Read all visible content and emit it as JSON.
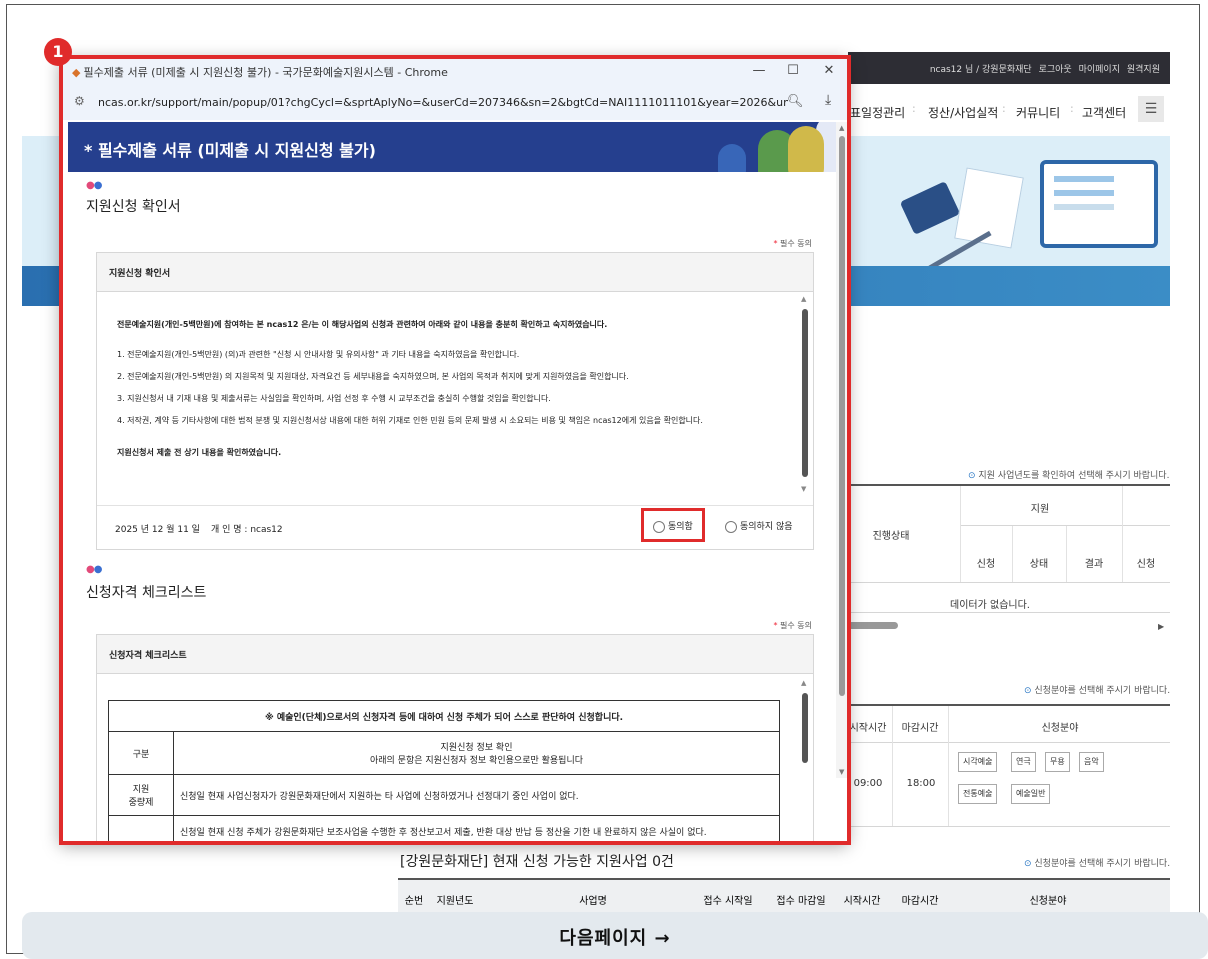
{
  "popup": {
    "window_title": "필수제출 서류 (미제출 시 지원신청 불가) - 국가문화예술지원시스템 - Chrome",
    "minimize": "—",
    "maximize": "☐",
    "close": "✕",
    "url": "ncas.or.kr/support/main/popup/01?chgCycl=&sprtAplyNo=&userCd=207346&sn=2&bgtCd=NAI1111011101&year=2026&unitBizC...",
    "header_title": "* 필수제출 서류 (미제출 시 지원신청 불가)",
    "section1": {
      "title": "지원신청 확인서",
      "required_label": "필수 동의",
      "box_title": "지원신청 확인서",
      "lead": "전문예술지원(개인-5백만원)에 참여하는 본 ncas12 은/는 이 해당사업의 신청과 관련하여 아래와 같이 내용을 충분히 확인하고 숙지하였습니다.",
      "items": [
        "1. 전문예술지원(개인-5백만원) (의)과 관련한 \"신청 시 안내사항 및 유의사항\" 과 기타 내용을 숙지하였음을 확인합니다.",
        "2. 전문예술지원(개인-5백만원) 의 지원목적 및 지원대상, 자격요건 등 세부내용을 숙지하였으며, 본 사업의 목적과 취지에 맞게 지원하였음을 확인합니다.",
        "3. 지원신청서 내 기재 내용 및 제출서류는 사실임을 확인하며, 사업 선정 후 수행 시 교부조건을 충실히 수행할 것임을 확인합니다.",
        "4. 저작권, 계약 등 기타사항에 대한 법적 분쟁 및 지원신청서상 내용에 대한 허위 기재로 인한 민원 등의 문제 발생 시 소요되는 비용 및 책임은 ncas12에게 있음을 확인합니다."
      ],
      "closing": "지원신청서 제출 전 상기 내용을 확인하였습니다.",
      "date": "2025 년 12 월 11 일",
      "person": "개 인 명 : ncas12",
      "agree": "동의함",
      "disagree": "동의하지 않음"
    },
    "section2": {
      "title": "신청자격 체크리스트",
      "required_label": "필수 동의",
      "box_title": "신청자격 체크리스트",
      "table_title": "※ 예술인(단체)으로서의 신청자격 등에 대하여 신청 주체가 되어 스스로 판단하여 신청합니다.",
      "col1_header": "구분",
      "col2_header_line1": "지원신청 정보 확인",
      "col2_header_line2": "아래의 문항은 지원신청자 정보 확인용으로만 활용됩니다",
      "row1_label_line1": "지원",
      "row1_label_line2": "중량제",
      "row1_text": "신청일 현재 사업신청자가 강원문화재단에서 지원하는 타 사업에 신청하였거나 선정대기 중인 사업이 없다.",
      "row2_text": "신청일 현재 신청 주체가 강원문화재단 보조사업을 수행한 후 정산보고서 제출, 반환 대상 반납 등 정산을 기한 내 완료하지 않은 사실이 없다."
    }
  },
  "background_site": {
    "top_links": [
      "ncas12 님 / 강원문화재단",
      "로그아웃",
      "마이페이지",
      "원격지원"
    ],
    "nav": [
      "표일정관리",
      "정산/사업실적",
      "커뮤니티",
      "고객센터"
    ],
    "note1": "지원 사업년도를 확인하여 선택해 주시기 바랍니다.",
    "table1": {
      "status_header": "진행상태",
      "group_header": "지원",
      "sub_headers": [
        "신청",
        "상태",
        "결과",
        "신청"
      ],
      "empty": "데이터가 없습니다."
    },
    "note2": "신청분야를 선택해 주시기 바랍니다.",
    "table2": {
      "headers": [
        "시작시간",
        "마감시간",
        "신청분야"
      ],
      "start": "09:00",
      "end": "18:00",
      "fields": [
        "시각예술",
        "연극",
        "무용",
        "음악",
        "전통예술",
        "예술일반"
      ]
    },
    "heading": "[강원문화재단] 현재 신청 가능한 지원사업 0건",
    "note3": "신청분야를 선택해 주시기 바랍니다.",
    "table3_headers": [
      "순번",
      "지원년도",
      "사업명",
      "접수 시작일",
      "접수 마감일",
      "시작시간",
      "마감시간",
      "신청분야"
    ]
  },
  "annotation_badge": "1",
  "next_page": "다음페이지 →"
}
